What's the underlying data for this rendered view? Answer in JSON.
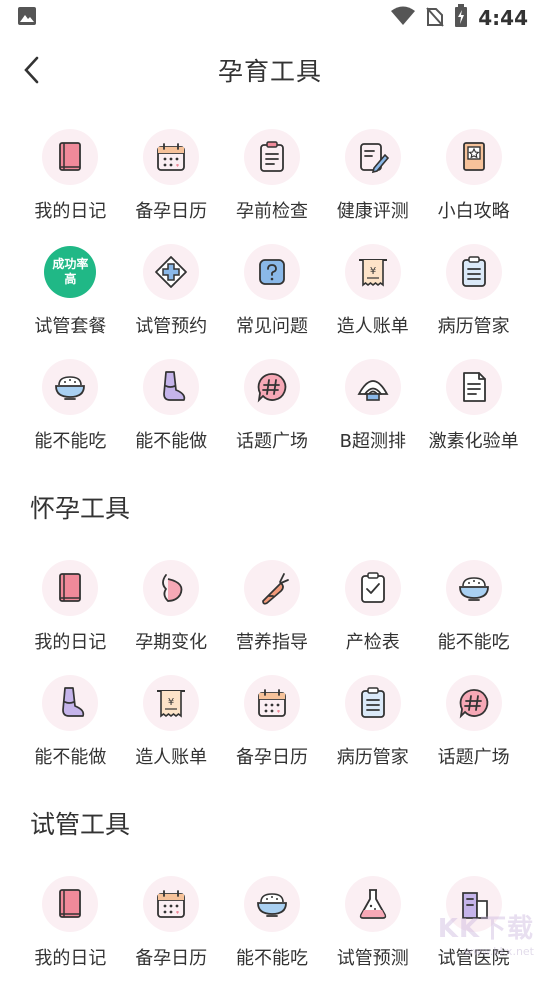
{
  "status_bar": {
    "time": "4:44"
  },
  "header": {
    "title": "孕育工具"
  },
  "section1": {
    "items": [
      {
        "label": "我的日记",
        "icon": "diary-book-icon"
      },
      {
        "label": "备孕日历",
        "icon": "calendar-icon"
      },
      {
        "label": "孕前检查",
        "icon": "checklist-clipboard-icon"
      },
      {
        "label": "健康评测",
        "icon": "health-assessment-icon"
      },
      {
        "label": "小白攻略",
        "icon": "guide-book-icon"
      },
      {
        "label": "试管套餐",
        "icon": "success-rate-badge",
        "badge": "成功率高"
      },
      {
        "label": "试管预约",
        "icon": "medical-cross-icon"
      },
      {
        "label": "常见问题",
        "icon": "question-icon"
      },
      {
        "label": "造人账单",
        "icon": "bill-receipt-icon"
      },
      {
        "label": "病历管家",
        "icon": "medical-record-icon"
      },
      {
        "label": "能不能吃",
        "icon": "food-bowl-icon"
      },
      {
        "label": "能不能做",
        "icon": "foot-icon"
      },
      {
        "label": "话题广场",
        "icon": "topic-hashtag-icon"
      },
      {
        "label": "B超测排",
        "icon": "ultrasound-icon"
      },
      {
        "label": "激素化验单",
        "icon": "lab-report-icon"
      }
    ]
  },
  "section2": {
    "title": "怀孕工具",
    "items": [
      {
        "label": "我的日记",
        "icon": "diary-book-icon"
      },
      {
        "label": "孕期变化",
        "icon": "pregnancy-belly-icon"
      },
      {
        "label": "营养指导",
        "icon": "carrot-icon"
      },
      {
        "label": "产检表",
        "icon": "checkup-clipboard-icon"
      },
      {
        "label": "能不能吃",
        "icon": "food-bowl-icon"
      },
      {
        "label": "能不能做",
        "icon": "foot-icon"
      },
      {
        "label": "造人账单",
        "icon": "bill-receipt-icon"
      },
      {
        "label": "备孕日历",
        "icon": "calendar-icon"
      },
      {
        "label": "病历管家",
        "icon": "medical-record-icon"
      },
      {
        "label": "话题广场",
        "icon": "topic-hashtag-icon"
      }
    ]
  },
  "section3": {
    "title": "试管工具",
    "items": [
      {
        "label": "我的日记",
        "icon": "diary-book-icon"
      },
      {
        "label": "备孕日历",
        "icon": "calendar-icon"
      },
      {
        "label": "能不能吃",
        "icon": "food-bowl-icon"
      },
      {
        "label": "试管预测",
        "icon": "lab-flask-icon"
      },
      {
        "label": "试管医院",
        "icon": "hospital-icon"
      }
    ]
  },
  "watermark": {
    "brand": "KK下载",
    "url": "www.kkx.net"
  },
  "colors": {
    "accent": "#f08a9a",
    "icon_bg": "#fbeff3",
    "badge": "#20b886",
    "outline": "#333333"
  }
}
